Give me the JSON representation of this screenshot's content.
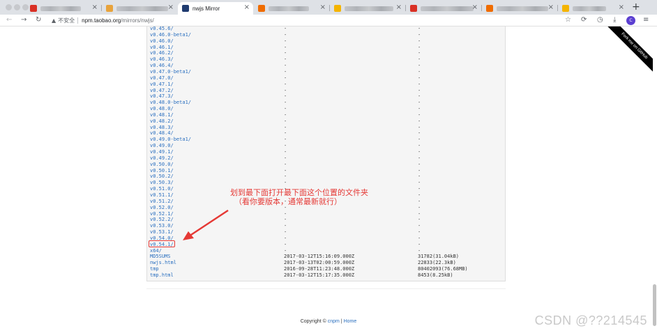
{
  "browser": {
    "active_tab_title": "nwjs Mirror",
    "url_warning": "不安全",
    "url_host": "npm.taobao.org",
    "url_path": "/mirrors/nwjs/",
    "avatar_initial": "C"
  },
  "tabs": [
    {
      "favicon_color": "#d93025"
    },
    {
      "favicon_color": "#e8a33c"
    },
    {
      "favicon_color": "#1f3b70",
      "active": true
    },
    {
      "favicon_color": "#ef6c00"
    },
    {
      "favicon_color": "#f4b400"
    },
    {
      "favicon_color": "#d93025"
    },
    {
      "favicon_color": "#ef6c00"
    },
    {
      "favicon_color": "#f4b400"
    }
  ],
  "listing": {
    "rows": [
      {
        "name": "v0.45.6/",
        "date": "-",
        "size": "-"
      },
      {
        "name": "v0.46.0-beta1/",
        "date": "-",
        "size": "-"
      },
      {
        "name": "v0.46.0/",
        "date": "-",
        "size": "-"
      },
      {
        "name": "v0.46.1/",
        "date": "-",
        "size": "-"
      },
      {
        "name": "v0.46.2/",
        "date": "-",
        "size": "-"
      },
      {
        "name": "v0.46.3/",
        "date": "-",
        "size": "-"
      },
      {
        "name": "v0.46.4/",
        "date": "-",
        "size": "-"
      },
      {
        "name": "v0.47.0-beta1/",
        "date": "-",
        "size": "-"
      },
      {
        "name": "v0.47.0/",
        "date": "-",
        "size": "-"
      },
      {
        "name": "v0.47.1/",
        "date": "-",
        "size": "-"
      },
      {
        "name": "v0.47.2/",
        "date": "-",
        "size": "-"
      },
      {
        "name": "v0.47.3/",
        "date": "-",
        "size": "-"
      },
      {
        "name": "v0.48.0-beta1/",
        "date": "-",
        "size": "-"
      },
      {
        "name": "v0.48.0/",
        "date": "-",
        "size": "-"
      },
      {
        "name": "v0.48.1/",
        "date": "-",
        "size": "-"
      },
      {
        "name": "v0.48.2/",
        "date": "-",
        "size": "-"
      },
      {
        "name": "v0.48.3/",
        "date": "-",
        "size": "-"
      },
      {
        "name": "v0.48.4/",
        "date": "-",
        "size": "-"
      },
      {
        "name": "v0.49.0-beta1/",
        "date": "-",
        "size": "-"
      },
      {
        "name": "v0.49.0/",
        "date": "-",
        "size": "-"
      },
      {
        "name": "v0.49.1/",
        "date": "-",
        "size": "-"
      },
      {
        "name": "v0.49.2/",
        "date": "-",
        "size": "-"
      },
      {
        "name": "v0.50.0/",
        "date": "-",
        "size": "-"
      },
      {
        "name": "v0.50.1/",
        "date": "-",
        "size": "-"
      },
      {
        "name": "v0.50.2/",
        "date": "-",
        "size": "-"
      },
      {
        "name": "v0.50.3/",
        "date": "-",
        "size": "-"
      },
      {
        "name": "v0.51.0/",
        "date": "-",
        "size": "-"
      },
      {
        "name": "v0.51.1/",
        "date": "-",
        "size": "-"
      },
      {
        "name": "v0.51.2/",
        "date": "-",
        "size": "-"
      },
      {
        "name": "v0.52.0/",
        "date": "-",
        "size": "-"
      },
      {
        "name": "v0.52.1/",
        "date": "-",
        "size": "-"
      },
      {
        "name": "v0.52.2/",
        "date": "-",
        "size": "-"
      },
      {
        "name": "v0.53.0/",
        "date": "-",
        "size": "-"
      },
      {
        "name": "v0.53.1/",
        "date": "-",
        "size": "-"
      },
      {
        "name": "v0.54.0/",
        "date": "-",
        "size": "-"
      },
      {
        "name": "v0.54.1/",
        "date": "-",
        "size": "-",
        "highlighted": true
      },
      {
        "name": "x64/",
        "date": "-",
        "size": "-"
      },
      {
        "name": "MD5SUMS",
        "date": "2017-03-12T15:16:09.000Z",
        "size": "31782(31.04kB)"
      },
      {
        "name": "nwjs.html",
        "date": "2017-03-13T02:00:59.000Z",
        "size": "22833(22.3kB)"
      },
      {
        "name": "tmp",
        "date": "2016-09-28T11:23:48.000Z",
        "size": "80402093(76.68MB)"
      },
      {
        "name": "tmp.html",
        "date": "2017-03-12T15:17:35.000Z",
        "size": "8453(8.25kB)"
      }
    ]
  },
  "annotation": {
    "line1": "划到最下面打开最下面这个位置的文件夹",
    "line2": "（看你要版本，通常最新就行）",
    "color": "#e53935"
  },
  "ribbon": {
    "text": "Fork me on GitHub"
  },
  "footer": {
    "copyright": "Copyright ©",
    "link1": "cnpm",
    "separator": "|",
    "link2": "Home"
  },
  "watermark": "CSDN @??214545"
}
